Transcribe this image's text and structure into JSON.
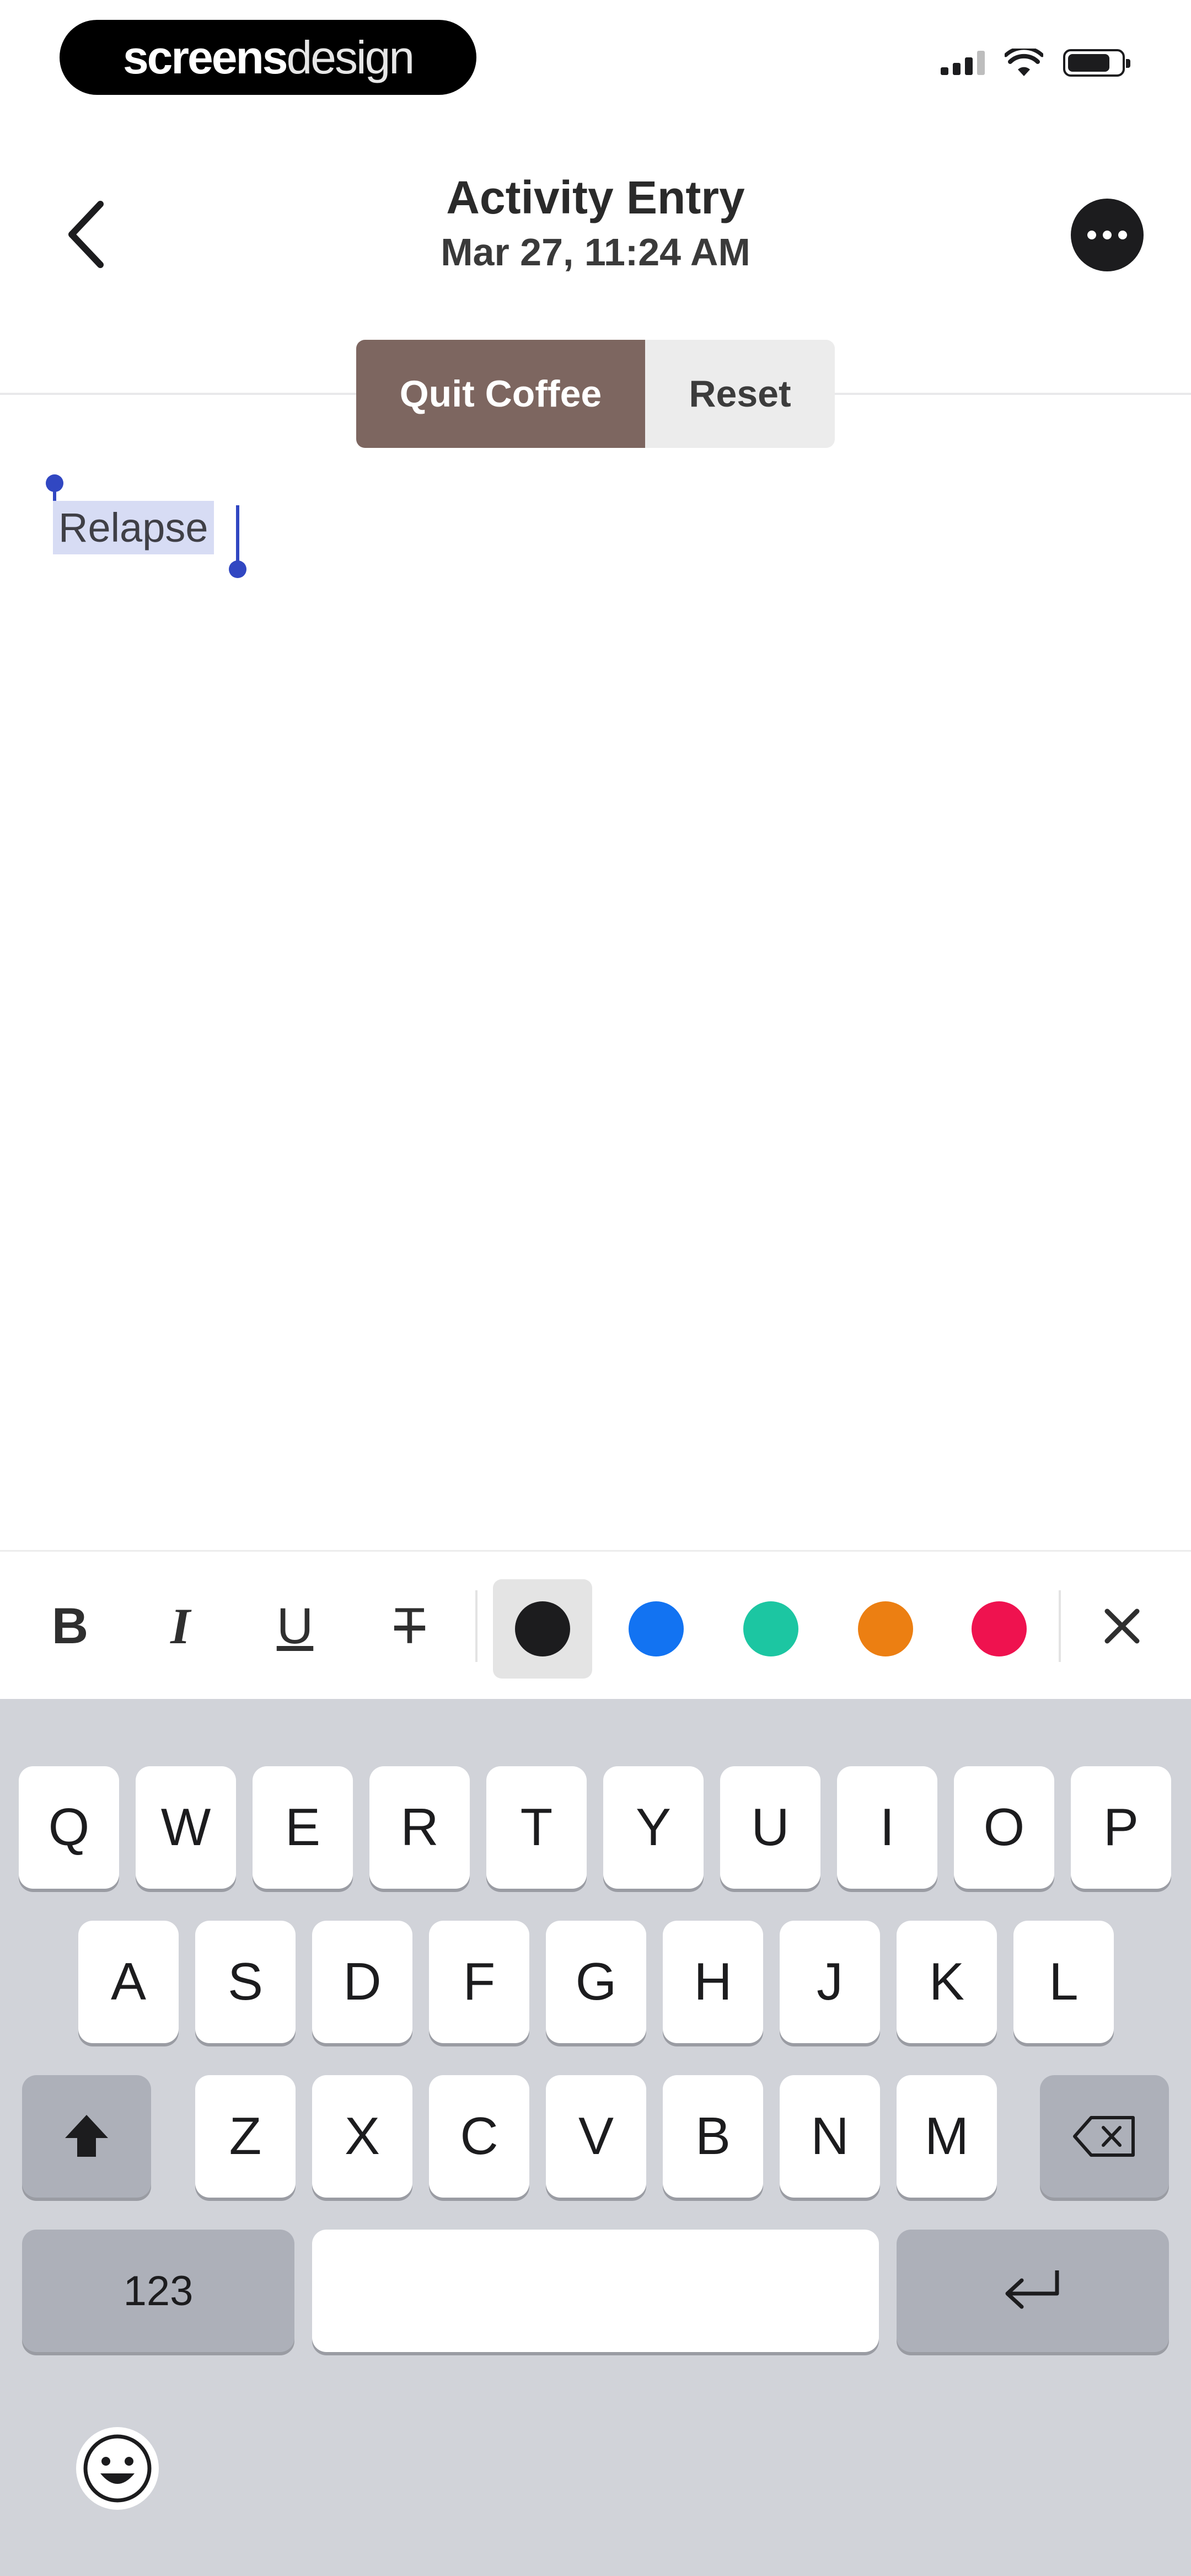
{
  "status_bar": {
    "brand_bold": "screens",
    "brand_light": "design"
  },
  "nav": {
    "title": "Activity Entry",
    "subtitle": "Mar 27, 11:24 AM"
  },
  "segmented": {
    "active_label": "Quit Coffee",
    "inactive_label": "Reset"
  },
  "editor": {
    "text": "Relapse"
  },
  "format_toolbar": {
    "bold": "B",
    "italic": "I",
    "underline": "U",
    "strikethrough": "T",
    "colors": [
      "#1c1c1e",
      "#1273f2",
      "#1cc6a2",
      "#ec7f12",
      "#ef124f"
    ],
    "active_color_index": 0
  },
  "keyboard": {
    "row1": [
      "Q",
      "W",
      "E",
      "R",
      "T",
      "Y",
      "U",
      "I",
      "O",
      "P"
    ],
    "row2": [
      "A",
      "S",
      "D",
      "F",
      "G",
      "H",
      "J",
      "K",
      "L"
    ],
    "row3": [
      "Z",
      "X",
      "C",
      "V",
      "B",
      "N",
      "M"
    ],
    "numbers_key": "123"
  }
}
